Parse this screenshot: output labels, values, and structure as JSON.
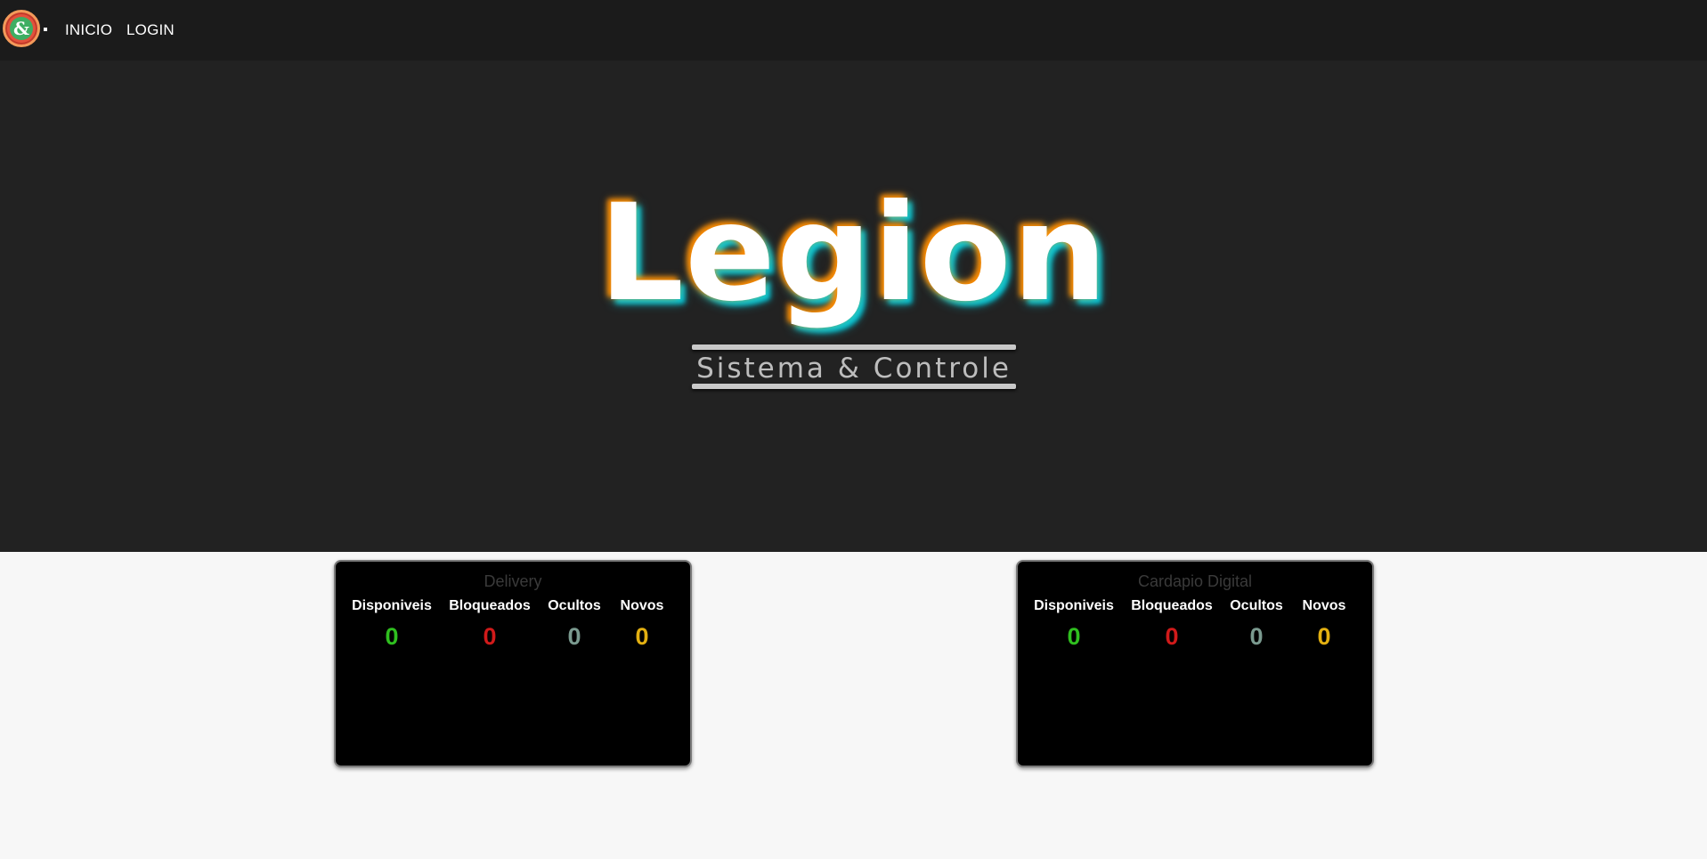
{
  "nav": {
    "logo_glyph": "&",
    "links": [
      "INICIO",
      "LOGIN"
    ]
  },
  "hero": {
    "title": "Legion",
    "subtitle": "Sistema & Controle"
  },
  "cards": [
    {
      "title": "Delivery",
      "stats": [
        {
          "label": "Disponiveis",
          "value": "0",
          "color": "#2fbf1f"
        },
        {
          "label": "Bloqueados",
          "value": "0",
          "color": "#d11a1a"
        },
        {
          "label": "Ocultos",
          "value": "0",
          "color": "#7a9a8f"
        },
        {
          "label": "Novos",
          "value": "0",
          "color": "#e3b011"
        }
      ]
    },
    {
      "title": "Cardapio Digital",
      "stats": [
        {
          "label": "Disponiveis",
          "value": "0",
          "color": "#2fbf1f"
        },
        {
          "label": "Bloqueados",
          "value": "0",
          "color": "#d11a1a"
        },
        {
          "label": "Ocultos",
          "value": "0",
          "color": "#7a9a8f"
        },
        {
          "label": "Novos",
          "value": "0",
          "color": "#e3b011"
        }
      ]
    }
  ],
  "colors": {
    "navbar_bg": "#1b1b1b",
    "hero_bg": "#222222",
    "glow_orange": "#ff8c00",
    "glow_cyan": "#00d2e6"
  }
}
